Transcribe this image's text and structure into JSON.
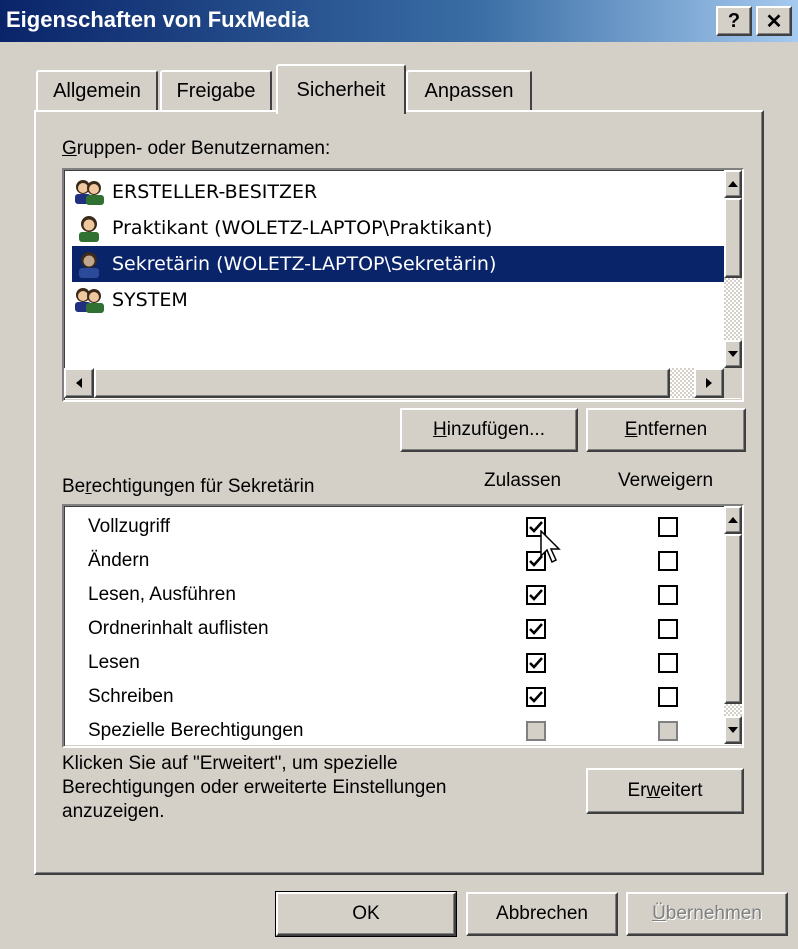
{
  "window": {
    "title": "Eigenschaften von FuxMedia",
    "help_label": "?",
    "close_label": "✕"
  },
  "tabs": [
    {
      "label": "Allgemein",
      "active": false
    },
    {
      "label": "Freigabe",
      "active": false
    },
    {
      "label": "Sicherheit",
      "active": true
    },
    {
      "label": "Anpassen",
      "active": false
    }
  ],
  "users": {
    "label_prefix_underlined": "G",
    "label_rest": "ruppen- oder Benutzernamen:",
    "items": [
      {
        "name": "ERSTELLER-BESITZER",
        "icon": "group-users-icon",
        "selected": false
      },
      {
        "name": "Praktikant (WOLETZ-LAPTOP\\Praktikant)",
        "icon": "user-icon",
        "selected": false
      },
      {
        "name": "Sekretärin (WOLETZ-LAPTOP\\Sekretärin)",
        "icon": "user-icon",
        "selected": true
      },
      {
        "name": "SYSTEM",
        "icon": "group-users-icon",
        "selected": false
      }
    ]
  },
  "buttons": {
    "add": {
      "u": "H",
      "rest": "inzufügen..."
    },
    "remove": {
      "u": "E",
      "rest": "ntfernen"
    },
    "advanced": {
      "pre": "Er",
      "u": "w",
      "rest": "eitert"
    },
    "ok": "OK",
    "cancel": "Abbrechen",
    "apply": {
      "u": "Ü",
      "rest": "bernehmen"
    }
  },
  "permissions": {
    "label_pre": "Be",
    "label_u": "r",
    "label_rest": "echtigungen für Sekretärin",
    "col_allow": "Zulassen",
    "col_deny": "Verweigern",
    "items": [
      {
        "name": "Vollzugriff",
        "allow": true,
        "deny": false
      },
      {
        "name": "Ändern",
        "allow": true,
        "deny": false
      },
      {
        "name": "Lesen, Ausführen",
        "allow": true,
        "deny": false
      },
      {
        "name": "Ordnerinhalt auflisten",
        "allow": true,
        "deny": false
      },
      {
        "name": "Lesen",
        "allow": true,
        "deny": false
      },
      {
        "name": "Schreiben",
        "allow": true,
        "deny": false
      },
      {
        "name": "Spezielle Berechtigungen",
        "allow": false,
        "deny": false
      }
    ]
  },
  "hint": {
    "line1": "Klicken Sie auf \"Erweitert\", um spezielle",
    "line2": "Berechtigungen oder erweiterte Einstellungen",
    "line3": "anzuzeigen."
  }
}
